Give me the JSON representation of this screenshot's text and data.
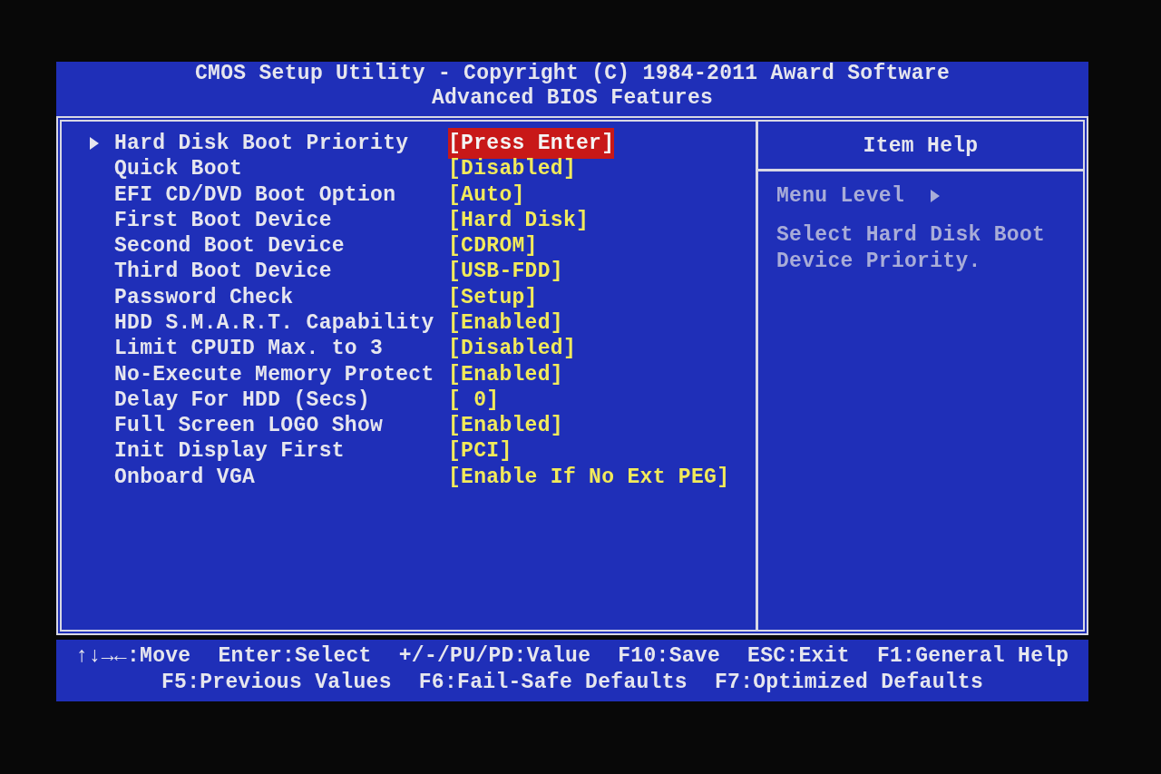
{
  "header": {
    "title": "CMOS Setup Utility - Copyright (C) 1984-2011 Award Software",
    "subtitle": "Advanced BIOS Features"
  },
  "items": [
    {
      "label": "Hard Disk Boot Priority",
      "value": "[Press Enter]",
      "submenu": true,
      "selected": true
    },
    {
      "label": "Quick Boot",
      "value": "[Disabled]",
      "submenu": false,
      "selected": false
    },
    {
      "label": "EFI CD/DVD Boot Option",
      "value": "[Auto]",
      "submenu": false,
      "selected": false
    },
    {
      "label": "First Boot Device",
      "value": "[Hard Disk]",
      "submenu": false,
      "selected": false
    },
    {
      "label": "Second Boot Device",
      "value": "[CDROM]",
      "submenu": false,
      "selected": false
    },
    {
      "label": "Third Boot Device",
      "value": "[USB-FDD]",
      "submenu": false,
      "selected": false
    },
    {
      "label": "Password Check",
      "value": "[Setup]",
      "submenu": false,
      "selected": false
    },
    {
      "label": "HDD S.M.A.R.T. Capability",
      "value": "[Enabled]",
      "submenu": false,
      "selected": false
    },
    {
      "label": "Limit CPUID Max. to 3",
      "value": "[Disabled]",
      "submenu": false,
      "selected": false
    },
    {
      "label": "No-Execute Memory Protect",
      "value": "[Enabled]",
      "submenu": false,
      "selected": false
    },
    {
      "label": "Delay For HDD (Secs)",
      "value": "[ 0]",
      "submenu": false,
      "selected": false
    },
    {
      "label": "Full Screen LOGO Show",
      "value": "[Enabled]",
      "submenu": false,
      "selected": false
    },
    {
      "label": "Init Display First",
      "value": "[PCI]",
      "submenu": false,
      "selected": false
    },
    {
      "label": "Onboard VGA",
      "value": "[Enable If No Ext PEG]",
      "submenu": false,
      "selected": false
    }
  ],
  "item_help": {
    "title": "Item Help",
    "menu_level": "Menu Level",
    "text": "Select Hard Disk Boot Device Priority."
  },
  "footer": [
    [
      "↑↓→←:Move",
      "Enter:Select",
      "+/-/PU/PD:Value",
      "F10:Save",
      "ESC:Exit",
      "F1:General Help"
    ],
    [
      "F5:Previous Values",
      "F6:Fail-Safe Defaults",
      "F7:Optimized Defaults"
    ]
  ]
}
